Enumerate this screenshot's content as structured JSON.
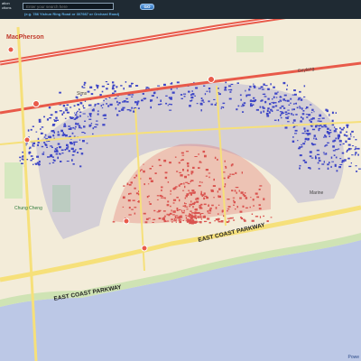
{
  "toolbar": {
    "side_title_line1": "ation",
    "side_title_line2": "ctions",
    "search_placeholder": "Enter your search here",
    "go_label": "GO",
    "hint_text": "(e.g. 786 Yishun Ring Road or 307987 or Orchard Road)"
  },
  "map_labels": {
    "macpherson": "MacPherson",
    "east_coast_parkway": "EAST COAST PARKWAY",
    "east_coast_parkway_2": "EAST COAST PARKWAY",
    "chung_cheng": "Chung Cheng",
    "sims": "Sims",
    "geylang": "Geylang",
    "marine": "Marine"
  },
  "corner_label": "Powe",
  "colors": {
    "water": "#bcc8e6",
    "blue_zone": "#4650c8",
    "red_zone": "#e0645f",
    "expressway": "#e85a4a",
    "road_yellow": "#f6e07a"
  }
}
